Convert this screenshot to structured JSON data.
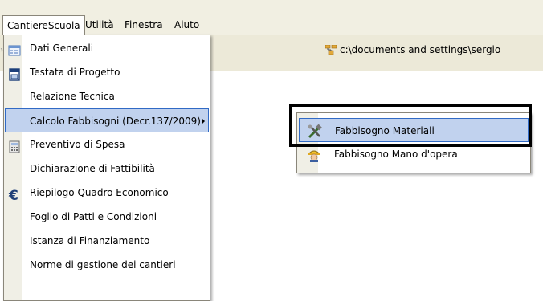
{
  "menubar": {
    "items": [
      {
        "label": "CantiereScuola"
      },
      {
        "label": "Utilità"
      },
      {
        "label": "Finestra"
      },
      {
        "label": "Aiuto"
      }
    ]
  },
  "toolbar": {
    "path": "c:\\documents and settings\\sergio"
  },
  "dropdown": {
    "items": [
      {
        "label": "Dati Generali",
        "icon": "form-icon"
      },
      {
        "label": "Testata di Progetto",
        "icon": "document-icon"
      },
      {
        "label": "Relazione Tecnica",
        "icon": ""
      },
      {
        "label": "Calcolo Fabbisogni (Decr.137/2009)",
        "icon": "",
        "submenu": true,
        "highlighted": true
      },
      {
        "label": "Preventivo di Spesa",
        "icon": "calculator-icon"
      },
      {
        "label": "Dichiarazione di Fattibilità",
        "icon": ""
      },
      {
        "label": "Riepilogo Quadro Economico",
        "icon": "euro-icon"
      },
      {
        "label": "Foglio di Patti e Condizioni",
        "icon": ""
      },
      {
        "label": "Istanza di Finanziamento",
        "icon": ""
      },
      {
        "label": "Norme di gestione dei cantieri",
        "icon": ""
      }
    ]
  },
  "submenu": {
    "items": [
      {
        "label": "Fabbisogno Materiali",
        "icon": "tools-icon",
        "highlighted": true
      },
      {
        "label": "Fabbisogno Mano d'opera",
        "icon": "worker-icon"
      }
    ]
  },
  "colors": {
    "menubar_bg": "#f1efe2",
    "highlight_bg": "#c1d2ee",
    "highlight_border": "#316ac5",
    "callout": "#000000"
  }
}
